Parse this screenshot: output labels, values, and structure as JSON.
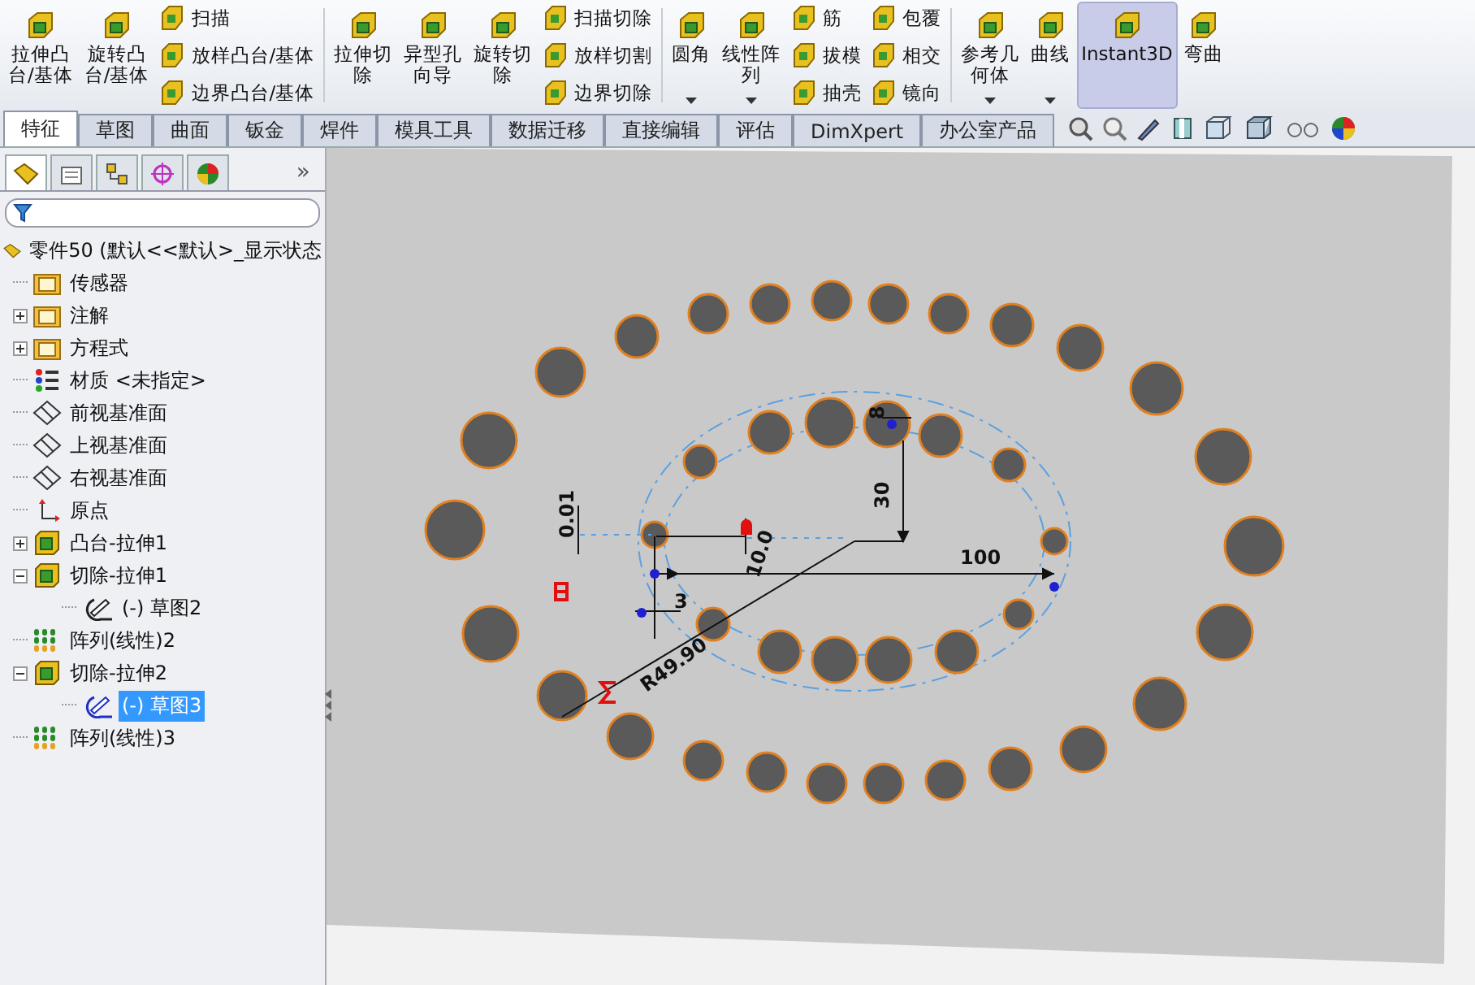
{
  "ribbon": [
    {
      "kind": "large",
      "lines": [
        "拉伸凸",
        "台/基体"
      ],
      "pressed": false,
      "menu": false
    },
    {
      "kind": "large",
      "lines": [
        "旋转凸",
        "台/基体"
      ],
      "pressed": false,
      "menu": false
    },
    {
      "kind": "stack",
      "items": [
        {
          "label": "扫描"
        },
        {
          "label": "放样凸台/基体"
        },
        {
          "label": "边界凸台/基体"
        }
      ]
    },
    {
      "kind": "separator"
    },
    {
      "kind": "large",
      "lines": [
        "拉伸切",
        "除"
      ],
      "pressed": false,
      "menu": false
    },
    {
      "kind": "large",
      "lines": [
        "异型孔",
        "向导"
      ],
      "pressed": false,
      "menu": false
    },
    {
      "kind": "large",
      "lines": [
        "旋转切",
        "除"
      ],
      "pressed": false,
      "menu": false
    },
    {
      "kind": "stack",
      "items": [
        {
          "label": "扫描切除"
        },
        {
          "label": "放样切割"
        },
        {
          "label": "边界切除"
        }
      ]
    },
    {
      "kind": "separator"
    },
    {
      "kind": "large",
      "lines": [
        "圆角"
      ],
      "pressed": false,
      "menu": true
    },
    {
      "kind": "large",
      "lines": [
        "线性阵",
        "列"
      ],
      "pressed": false,
      "menu": true
    },
    {
      "kind": "stack",
      "items": [
        {
          "label": "筋"
        },
        {
          "label": "拔模"
        },
        {
          "label": "抽壳"
        }
      ]
    },
    {
      "kind": "stack",
      "items": [
        {
          "label": "包覆"
        },
        {
          "label": "相交"
        },
        {
          "label": "镜向"
        }
      ]
    },
    {
      "kind": "separator"
    },
    {
      "kind": "large",
      "lines": [
        "参考几",
        "何体"
      ],
      "pressed": false,
      "menu": true
    },
    {
      "kind": "large",
      "lines": [
        "曲线"
      ],
      "pressed": false,
      "menu": true
    },
    {
      "kind": "large",
      "lines": [
        "Instant3D"
      ],
      "pressed": true,
      "menu": false
    },
    {
      "kind": "large",
      "lines": [
        "弯曲"
      ],
      "pressed": false,
      "menu": false
    }
  ],
  "tabs": [
    {
      "label": "特征",
      "selected": true
    },
    {
      "label": "草图",
      "selected": false
    },
    {
      "label": "曲面",
      "selected": false
    },
    {
      "label": "钣金",
      "selected": false
    },
    {
      "label": "焊件",
      "selected": false
    },
    {
      "label": "模具工具",
      "selected": false
    },
    {
      "label": "数据迁移",
      "selected": false
    },
    {
      "label": "直接编辑",
      "selected": false
    },
    {
      "label": "评估",
      "selected": false
    },
    {
      "label": "DimXpert",
      "selected": false
    },
    {
      "label": "办公室产品",
      "selected": false
    }
  ],
  "panel_tabs": [
    {
      "selected": true
    },
    {
      "selected": false
    },
    {
      "selected": false
    },
    {
      "selected": false
    },
    {
      "selected": false
    }
  ],
  "panel_more": "»",
  "tree": {
    "label": "零件50  (默认<<默认>_显示状态",
    "children": [
      {
        "label": "传感器",
        "kind": "folder",
        "expandable": false,
        "selected": false
      },
      {
        "label": "注解",
        "kind": "folder",
        "expandable": true,
        "expanded": false,
        "selected": false
      },
      {
        "label": "方程式",
        "kind": "folder",
        "expandable": true,
        "expanded": false,
        "selected": false
      },
      {
        "label": "材质 <未指定>",
        "kind": "material",
        "expandable": false,
        "selected": false
      },
      {
        "label": "前视基准面",
        "kind": "plane",
        "expandable": false,
        "selected": false
      },
      {
        "label": "上视基准面",
        "kind": "plane",
        "expandable": false,
        "selected": false
      },
      {
        "label": "右视基准面",
        "kind": "plane",
        "expandable": false,
        "selected": false
      },
      {
        "label": "原点",
        "kind": "origin",
        "expandable": false,
        "selected": false
      },
      {
        "label": "凸台-拉伸1",
        "kind": "feature",
        "expandable": true,
        "expanded": false,
        "selected": false
      },
      {
        "label": "切除-拉伸1",
        "kind": "feature",
        "expandable": true,
        "expanded": true,
        "selected": false,
        "children": [
          {
            "label": "(-) 草图2",
            "kind": "sketch",
            "expandable": false,
            "selected": false
          }
        ]
      },
      {
        "label": "阵列(线性)2",
        "kind": "pattern",
        "expandable": false,
        "selected": false
      },
      {
        "label": "切除-拉伸2",
        "kind": "feature",
        "expandable": true,
        "expanded": true,
        "selected": false,
        "children": [
          {
            "label": "(-) 草图3",
            "kind": "sketch",
            "expandable": false,
            "selected": true
          }
        ]
      },
      {
        "label": "阵列(线性)3",
        "kind": "pattern",
        "expandable": false,
        "selected": false
      }
    ]
  },
  "sketch_dimensions": [
    {
      "text": "8"
    },
    {
      "text": "30"
    },
    {
      "text": "0.01"
    },
    {
      "text": "10.0"
    },
    {
      "text": "100"
    },
    {
      "text": "3"
    },
    {
      "text": "R49.90"
    }
  ]
}
